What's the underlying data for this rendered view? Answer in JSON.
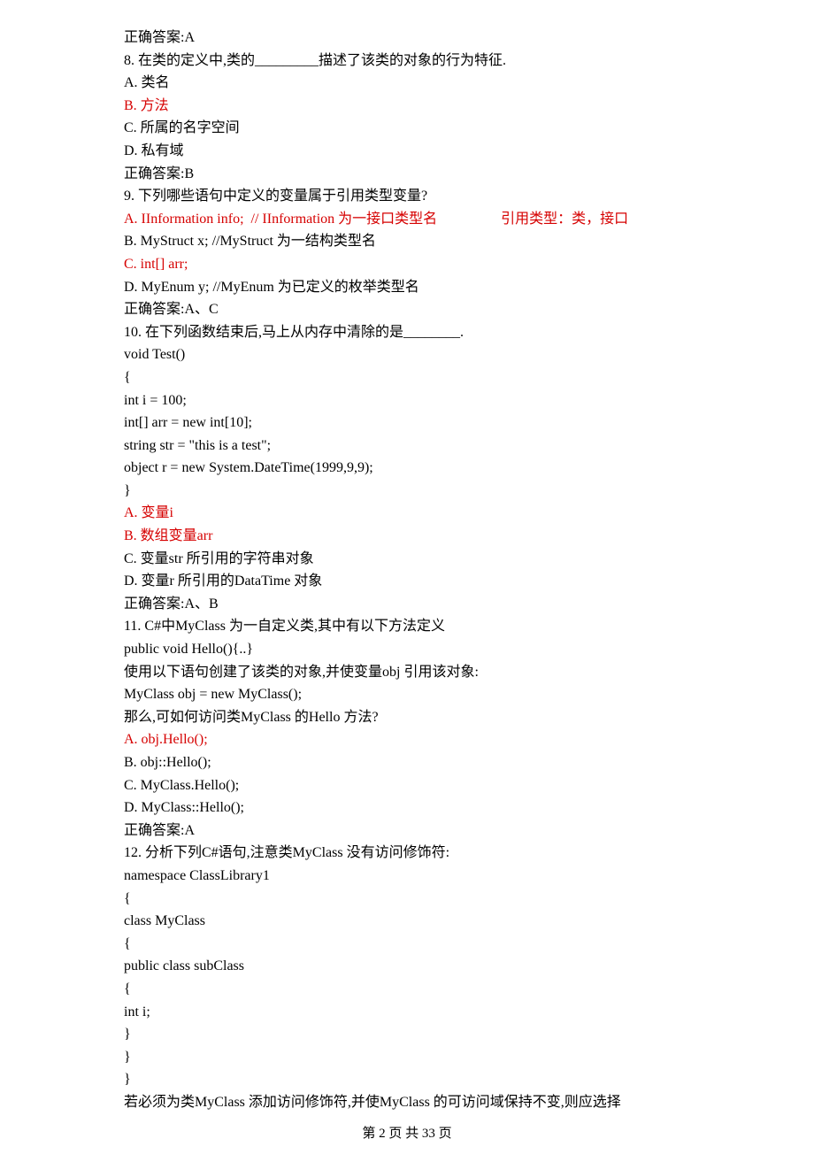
{
  "lines": [
    {
      "text": "正确答案:A"
    },
    {
      "text": "8. 在类的定义中,类的_________描述了该类的对象的行为特征."
    },
    {
      "text": "A. 类名"
    },
    {
      "text": "B. 方法",
      "red": true
    },
    {
      "text": "C. 所属的名字空间"
    },
    {
      "text": "D. 私有域"
    },
    {
      "text": "正确答案:B"
    },
    {
      "text": "9. 下列哪些语句中定义的变量属于引用类型变量?"
    },
    {
      "text": "A. IInformation info;  // IInformation 为一接口类型名                  引用类型：类，接口",
      "red": true
    },
    {
      "text": "B. MyStruct x; //MyStruct 为一结构类型名"
    },
    {
      "text": "C. int[] arr;",
      "red": true
    },
    {
      "text": "D. MyEnum y; //MyEnum 为已定义的枚举类型名"
    },
    {
      "text": "正确答案:A、C"
    },
    {
      "text": "10. 在下列函数结束后,马上从内存中清除的是________."
    },
    {
      "text": "void Test()"
    },
    {
      "text": "{"
    },
    {
      "text": "int i = 100;"
    },
    {
      "text": "int[] arr = new int[10];"
    },
    {
      "text": "string str = \"this is a test\";"
    },
    {
      "text": "object r = new System.DateTime(1999,9,9);"
    },
    {
      "text": "}"
    },
    {
      "text": "A. 变量i",
      "red": true
    },
    {
      "text": "B. 数组变量arr",
      "red": true
    },
    {
      "text": "C. 变量str 所引用的字符串对象"
    },
    {
      "text": "D. 变量r 所引用的DataTime 对象"
    },
    {
      "text": "正确答案:A、B"
    },
    {
      "text": "11. C#中MyClass 为一自定义类,其中有以下方法定义"
    },
    {
      "text": "public void Hello(){..}"
    },
    {
      "text": "使用以下语句创建了该类的对象,并使变量obj 引用该对象:"
    },
    {
      "text": "MyClass obj = new MyClass();"
    },
    {
      "text": "那么,可如何访问类MyClass 的Hello 方法?"
    },
    {
      "text": "A. obj.Hello();",
      "red": true
    },
    {
      "text": "B. obj::Hello();"
    },
    {
      "text": "C. MyClass.Hello();"
    },
    {
      "text": "D. MyClass::Hello();"
    },
    {
      "text": "正确答案:A"
    },
    {
      "text": "12. 分析下列C#语句,注意类MyClass 没有访问修饰符:"
    },
    {
      "text": "namespace ClassLibrary1"
    },
    {
      "text": "{"
    },
    {
      "text": "class MyClass"
    },
    {
      "text": "{"
    },
    {
      "text": "public class subClass"
    },
    {
      "text": "{"
    },
    {
      "text": "int i;"
    },
    {
      "text": "}"
    },
    {
      "text": "}"
    },
    {
      "text": "}"
    },
    {
      "text": "若必须为类MyClass 添加访问修饰符,并使MyClass 的可访问域保持不变,则应选择"
    }
  ],
  "footer": "第 2 页 共 33 页"
}
